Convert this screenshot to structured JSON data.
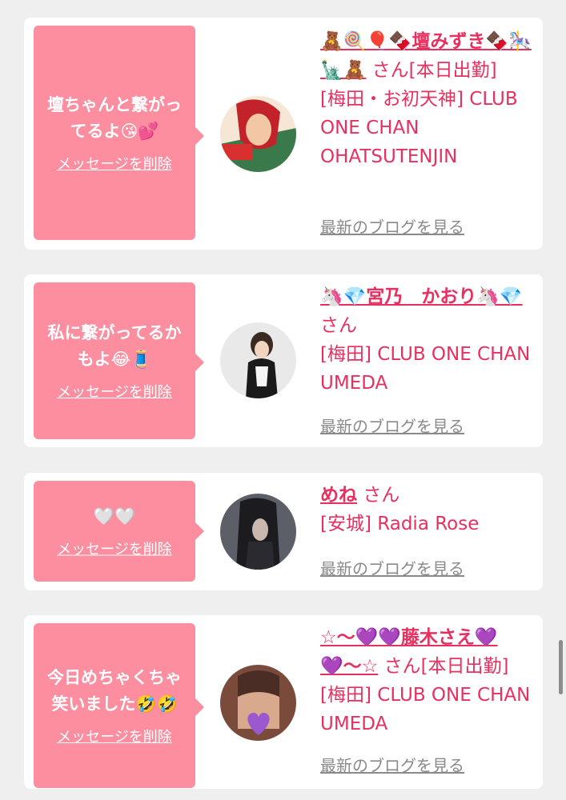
{
  "cards": [
    {
      "message": "壇ちゃんと繋がってるよ😘💕",
      "delete_label": "メッセージを削除",
      "name": "🧸🍭🎈🍫壇みずき🍫🎠🗽🧸",
      "san": "さん",
      "status": "[本日出勤]",
      "shop": "[梅田・お初天神] CLUB ONE CHAN OHATSUTENJIN",
      "blog_label": "最新のブログを見る",
      "avatar_colors": [
        "#c2232b",
        "#f2c7a5",
        "#3a7a4a"
      ]
    },
    {
      "message": "私に繋がってるかもよ😂🧵",
      "delete_label": "メッセージを削除",
      "name": "🦄💎宮乃　かおり🦄💎",
      "san": "さん",
      "status": "",
      "shop": "[梅田] CLUB ONE CHAN UMEDA",
      "blog_label": "最新のブログを見る",
      "avatar_colors": [
        "#e9e9e9",
        "#3b2a22",
        "#1a1a1a"
      ]
    },
    {
      "message": "🤍🤍",
      "delete_label": "メッセージを削除",
      "name": "めね",
      "san": "さん",
      "status": "",
      "shop": "[安城] Radia Rose",
      "blog_label": "最新のブログを見る",
      "avatar_colors": [
        "#5d5f68",
        "#1c1c20",
        "#c8b8b0"
      ]
    },
    {
      "message": "今日めちゃくちゃ笑いました🤣🤣",
      "delete_label": "メッセージを削除",
      "name": "☆〜💜💜藤木さえ💜💜〜☆",
      "san": "さん",
      "status": "[本日出勤]",
      "shop": "[梅田] CLUB ONE CHAN UMEDA",
      "blog_label": "最新のブログを見る",
      "avatar_colors": [
        "#d9a98e",
        "#7a4a3a",
        "#9b59d0"
      ]
    }
  ],
  "colors": {
    "accent": "#e8305f",
    "bubble": "#fd8ea0",
    "link_gray": "#8a8a8a",
    "background": "#efefef"
  }
}
